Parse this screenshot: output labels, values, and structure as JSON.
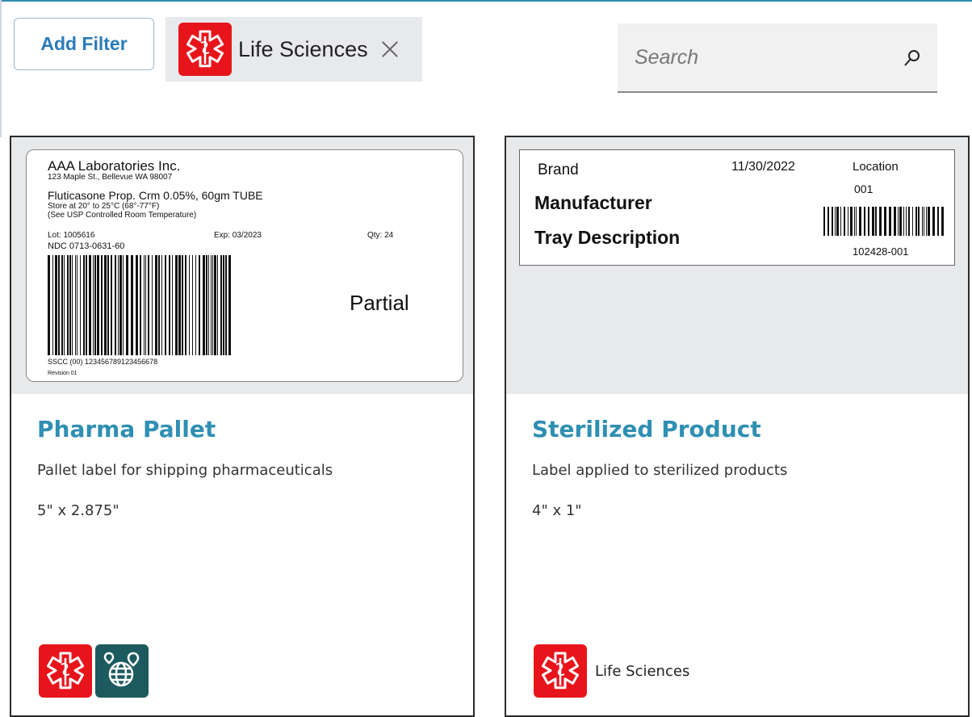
{
  "toolbar": {
    "add_filter_label": "Add Filter",
    "active_filter": {
      "label": "Life Sciences",
      "icon": "life-sciences-icon",
      "color": "#e8141b"
    },
    "search": {
      "placeholder": "Search",
      "value": ""
    }
  },
  "cards": [
    {
      "title": "Pharma Pallet",
      "description": "Pallet label for shipping pharmaceuticals",
      "size": "5\" x 2.875\"",
      "tags": [
        {
          "icon": "life-sciences-icon",
          "color": "#e8141b"
        },
        {
          "icon": "global-logistics-icon",
          "color": "#1d5a5f"
        }
      ],
      "preview": {
        "company": "AAA Laboratories Inc.",
        "address": "123 Maple St., Bellevue WA 98007",
        "product": "Fluticasone Prop. Crm 0.05%, 60gm TUBE",
        "storage": "Store at 20° to 25°C (68°-77°F)",
        "usp_note": "(See USP Controlled Room Temperature)",
        "lot": "Lot: 1005616",
        "expiry": "Exp: 03/2023",
        "qty": "Qty: 24",
        "ndc": "NDC 0713-0631-60",
        "status": "Partial",
        "sscc": "SSCC (00) 123456789123456678",
        "revision": "Revision 01"
      }
    },
    {
      "title": "Sterilized Product",
      "description": "Label applied to sterilized products",
      "size": "4\" x 1\"",
      "tags": [
        {
          "icon": "life-sciences-icon",
          "color": "#e8141b",
          "label": "Life Sciences"
        }
      ],
      "preview": {
        "brand": "Brand",
        "date": "11/30/2022",
        "location_label": "Location",
        "location_value": "001",
        "manufacturer": "Manufacturer",
        "tray": "Tray Description",
        "barcode_text": "102428-001"
      }
    }
  ]
}
